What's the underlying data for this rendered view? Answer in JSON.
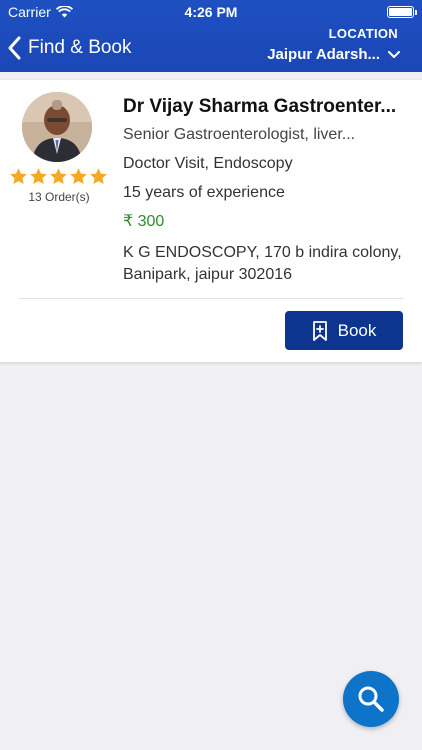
{
  "status_bar": {
    "carrier": "Carrier",
    "time": "4:26 PM"
  },
  "header": {
    "back_label": "Find & Book",
    "location_title": "LOCATION",
    "location_value": "Jaipur Adarsh...",
    "background": "#1e50c2"
  },
  "doctor": {
    "name": "Dr Vijay Sharma Gastroenter...",
    "specialty": "Senior Gastroenterologist, liver...",
    "services": "Doctor Visit, Endoscopy",
    "experience": "15 years of experience",
    "fee": "₹ 300",
    "address": "K G ENDOSCOPY, 170 b indira colony, Banipark, jaipur 302016",
    "rating": 5,
    "orders": "13 Order(s)"
  },
  "actions": {
    "book_label": "Book"
  },
  "icons": {
    "back": "chevron-left-icon",
    "location": "chevron-down-icon",
    "book": "bookmark-plus-icon",
    "search": "search-icon"
  },
  "colors": {
    "header": "#1e50c2",
    "book_button": "#0d3590",
    "fab": "#0d74c9",
    "star": "#f7a823",
    "fee": "#2e8b2e"
  }
}
